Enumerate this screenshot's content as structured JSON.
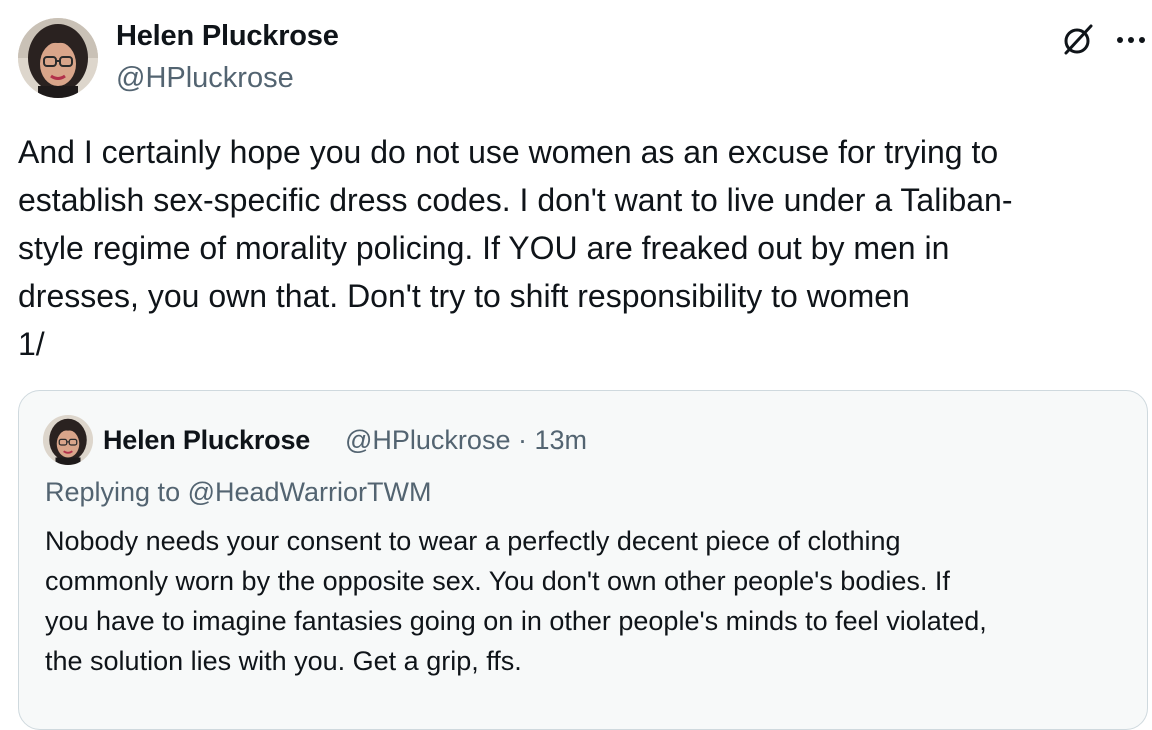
{
  "tweet": {
    "author": {
      "name": "Helen Pluckrose",
      "handle": "@HPluckrose"
    },
    "icons": {
      "grok": "grok-icon",
      "more": "more-icon"
    },
    "text": "And I certainly hope you do not use women as an excuse for trying to\nestablish sex-specific dress codes. I don't want to live under a Taliban-\nstyle regime of morality policing. If YOU are freaked out by men in\ndresses, you own that. Don't try to shift responsibility to women\n1/"
  },
  "quote": {
    "author": {
      "name": "Helen Pluckrose",
      "handle_time": "@HPluckrose · 13m"
    },
    "replying_to": "Replying to @HeadWarriorTWM",
    "text": "Nobody needs your consent to wear a perfectly decent piece of clothing\ncommonly worn by the opposite sex. You don't own other people's bodies. If\nyou have to imagine fantasies going on in other people's minds to feel violated,\nthe solution lies with you. Get a grip, ffs."
  },
  "colors": {
    "text_primary": "#0f1419",
    "text_secondary": "#536471",
    "quote_border": "#cfd9de",
    "quote_bg": "#f7f9f9"
  }
}
